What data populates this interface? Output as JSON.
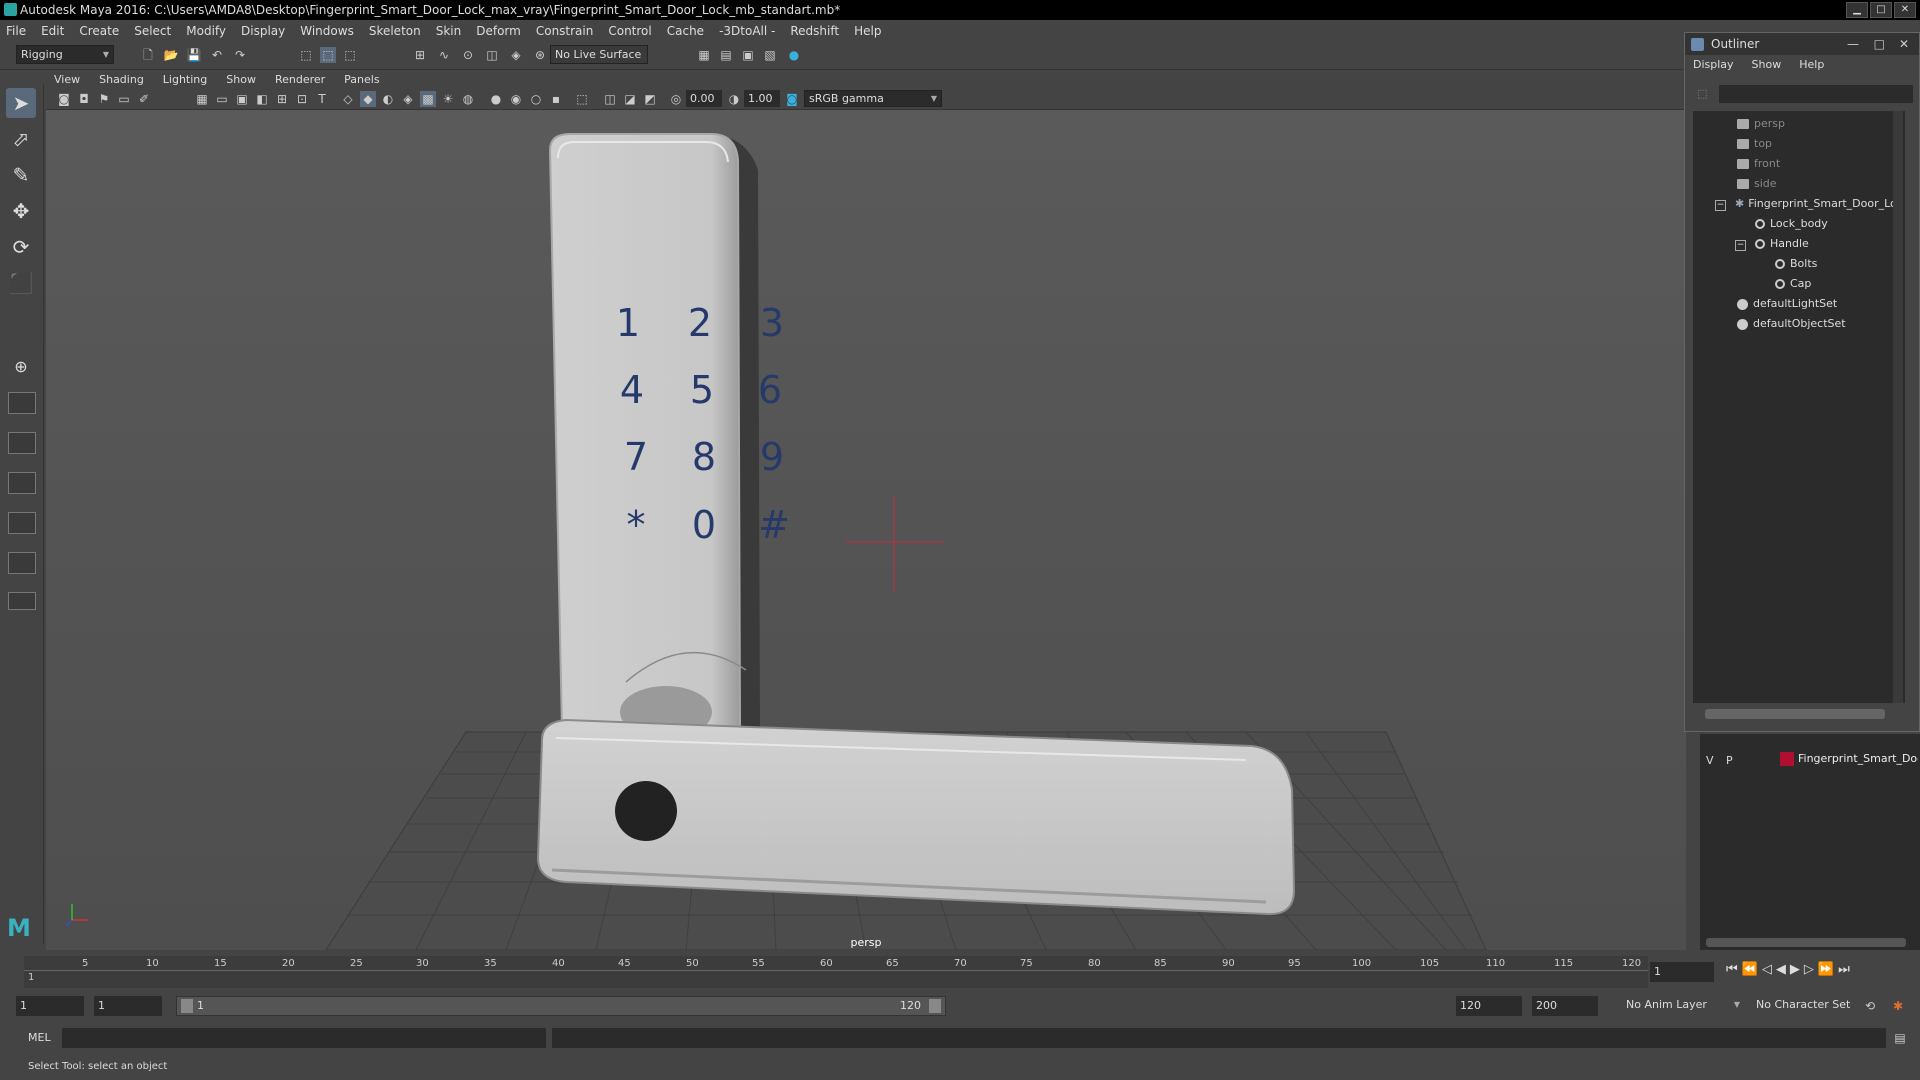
{
  "window": {
    "title": "Autodesk Maya 2016: C:\\Users\\AMDA8\\Desktop\\Fingerprint_Smart_Door_Lock_max_vray\\Fingerprint_Smart_Door_Lock_mb_standart.mb*"
  },
  "menubar": [
    "File",
    "Edit",
    "Create",
    "Select",
    "Modify",
    "Display",
    "Windows",
    "Skeleton",
    "Skin",
    "Deform",
    "Constrain",
    "Control",
    "Cache",
    "-3DtoAll -",
    "Redshift",
    "Help"
  ],
  "shelf": {
    "mode": "Rigging",
    "live_surface": "No Live Surface"
  },
  "panel": {
    "menus": [
      "View",
      "Shading",
      "Lighting",
      "Show",
      "Renderer",
      "Panels"
    ],
    "exposure": "0.00",
    "gamma": "1.00",
    "color_space": "sRGB gamma",
    "camera_label": "persp"
  },
  "model": {
    "keypad": [
      "1",
      "2",
      "3",
      "4",
      "5",
      "6",
      "7",
      "8",
      "9",
      "*",
      "0",
      "#"
    ]
  },
  "outliner": {
    "title": "Outliner",
    "menus": [
      "Display",
      "Show",
      "Help"
    ],
    "items": [
      {
        "label": "persp",
        "icon": "camera-icon"
      },
      {
        "label": "top",
        "icon": "camera-icon"
      },
      {
        "label": "front",
        "icon": "camera-icon"
      },
      {
        "label": "side",
        "icon": "camera-icon"
      },
      {
        "label": "Fingerprint_Smart_Door_Lo",
        "icon": "group-icon"
      },
      {
        "label": "Lock_body",
        "icon": "mesh-icon"
      },
      {
        "label": "Handle",
        "icon": "mesh-icon"
      },
      {
        "label": "Bolts",
        "icon": "mesh-icon"
      },
      {
        "label": "Cap",
        "icon": "mesh-icon"
      },
      {
        "label": "defaultLightSet",
        "icon": "set-icon"
      },
      {
        "label": "defaultObjectSet",
        "icon": "set-icon"
      }
    ]
  },
  "layers": {
    "v": "V",
    "p": "P",
    "name": "Fingerprint_Smart_Doo",
    "color": "#b01030"
  },
  "timeline": {
    "ticks": [
      "5",
      "10",
      "15",
      "20",
      "25",
      "30",
      "35",
      "40",
      "45",
      "50",
      "55",
      "60",
      "65",
      "70",
      "75",
      "80",
      "85",
      "90",
      "95",
      "100",
      "105",
      "110",
      "115",
      "120"
    ],
    "start_tick": "1",
    "current_frame": "1"
  },
  "range": {
    "start": "1",
    "playback_start": "1",
    "slider_start": "1",
    "slider_end": "120",
    "playback_end": "120",
    "end": "200",
    "anim_layer": "No Anim Layer",
    "character_set": "No Character Set"
  },
  "command": {
    "lang": "MEL"
  },
  "help_line": "Select Tool: select an object"
}
